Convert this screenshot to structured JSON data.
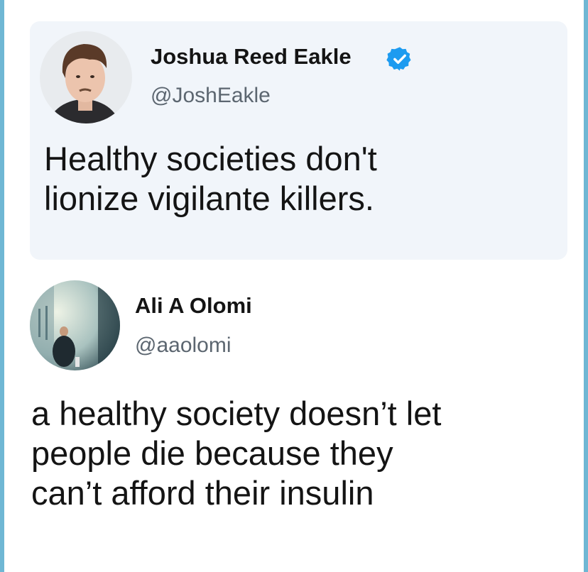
{
  "quoted_tweet": {
    "author_name": "Joshua Reed Eakle",
    "handle": "@JoshEakle",
    "verified": true,
    "text_lines": [
      "Healthy societies don't",
      "lionize vigilante killers."
    ]
  },
  "reply_tweet": {
    "author_name": "Ali A Olomi",
    "handle": "@aaolomi",
    "text_lines": [
      "a healthy society doesn’t let",
      "people die because they",
      "can’t afford their insulin"
    ]
  },
  "colors": {
    "frame_border": "#6fb7d4",
    "quoted_card_bg": "#f1f5fa",
    "verified_badge": "#1d9bf0",
    "name_text": "#141414",
    "handle_text": "#5c6670"
  },
  "icons": {
    "verified": "verified-badge-icon"
  }
}
